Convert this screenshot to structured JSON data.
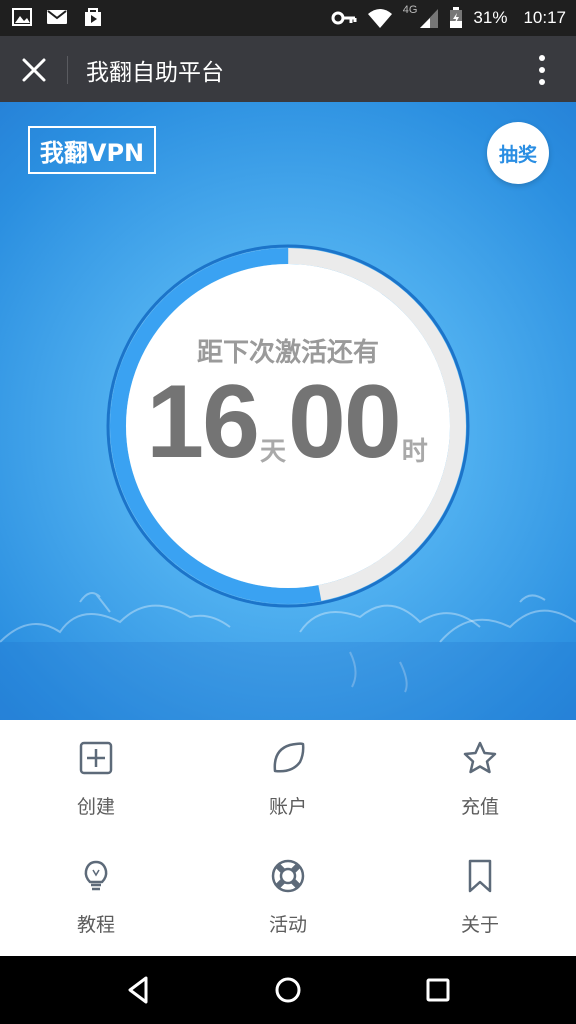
{
  "status_bar": {
    "network": "4G",
    "battery": "31%",
    "time": "10:17",
    "left_icons": [
      "image-icon",
      "mail-icon",
      "play-store-icon"
    ],
    "right_icons": [
      "key-icon",
      "wifi-icon",
      "signal-icon",
      "battery-icon"
    ]
  },
  "app_bar": {
    "title": "我翻自助平台",
    "close_icon": "close-icon",
    "more_icon": "more-vertical-icon"
  },
  "hero": {
    "logo_text": "我翻VPN",
    "lottery_label": "抽奖",
    "countdown_label": "距下次激活还有",
    "days_value": "16",
    "days_unit": "天",
    "hours_value": "00",
    "hours_unit": "时",
    "ring_progress_fraction": 0.53,
    "colors": {
      "ring_fill": "#3aa2f2",
      "ring_track": "#ebebeb",
      "accent": "#2a8ee3"
    }
  },
  "menu": {
    "items": [
      {
        "label": "创建",
        "icon": "plus-square-icon"
      },
      {
        "label": "账户",
        "icon": "leaf-icon"
      },
      {
        "label": "充值",
        "icon": "star-icon"
      },
      {
        "label": "教程",
        "icon": "lightbulb-icon"
      },
      {
        "label": "活动",
        "icon": "lifebuoy-icon"
      },
      {
        "label": "关于",
        "icon": "bookmark-icon"
      }
    ]
  },
  "nav_bar": {
    "icons": [
      "back-icon",
      "home-icon",
      "recents-icon"
    ]
  }
}
